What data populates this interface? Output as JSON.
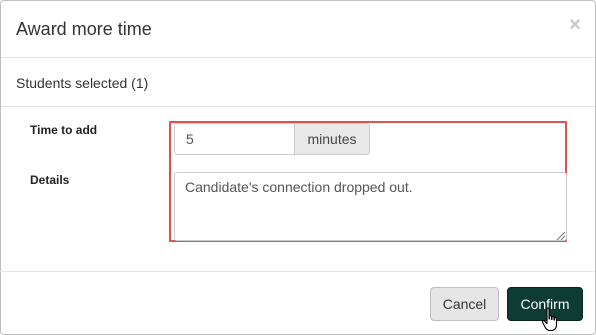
{
  "dialog": {
    "title": "Award more time",
    "close_label": "×"
  },
  "students": {
    "label": "Students selected (1)"
  },
  "form": {
    "time_label": "Time to add",
    "time_value": "5",
    "time_unit": "minutes",
    "details_label": "Details",
    "details_value": "Candidate's connection dropped out."
  },
  "footer": {
    "cancel_label": "Cancel",
    "confirm_label": "Confirm"
  },
  "colors": {
    "confirm_bg": "#0e3b33",
    "highlight_border": "#d9534f"
  },
  "icons": {
    "close": "close-icon",
    "cursor": "hand-pointer-icon"
  }
}
